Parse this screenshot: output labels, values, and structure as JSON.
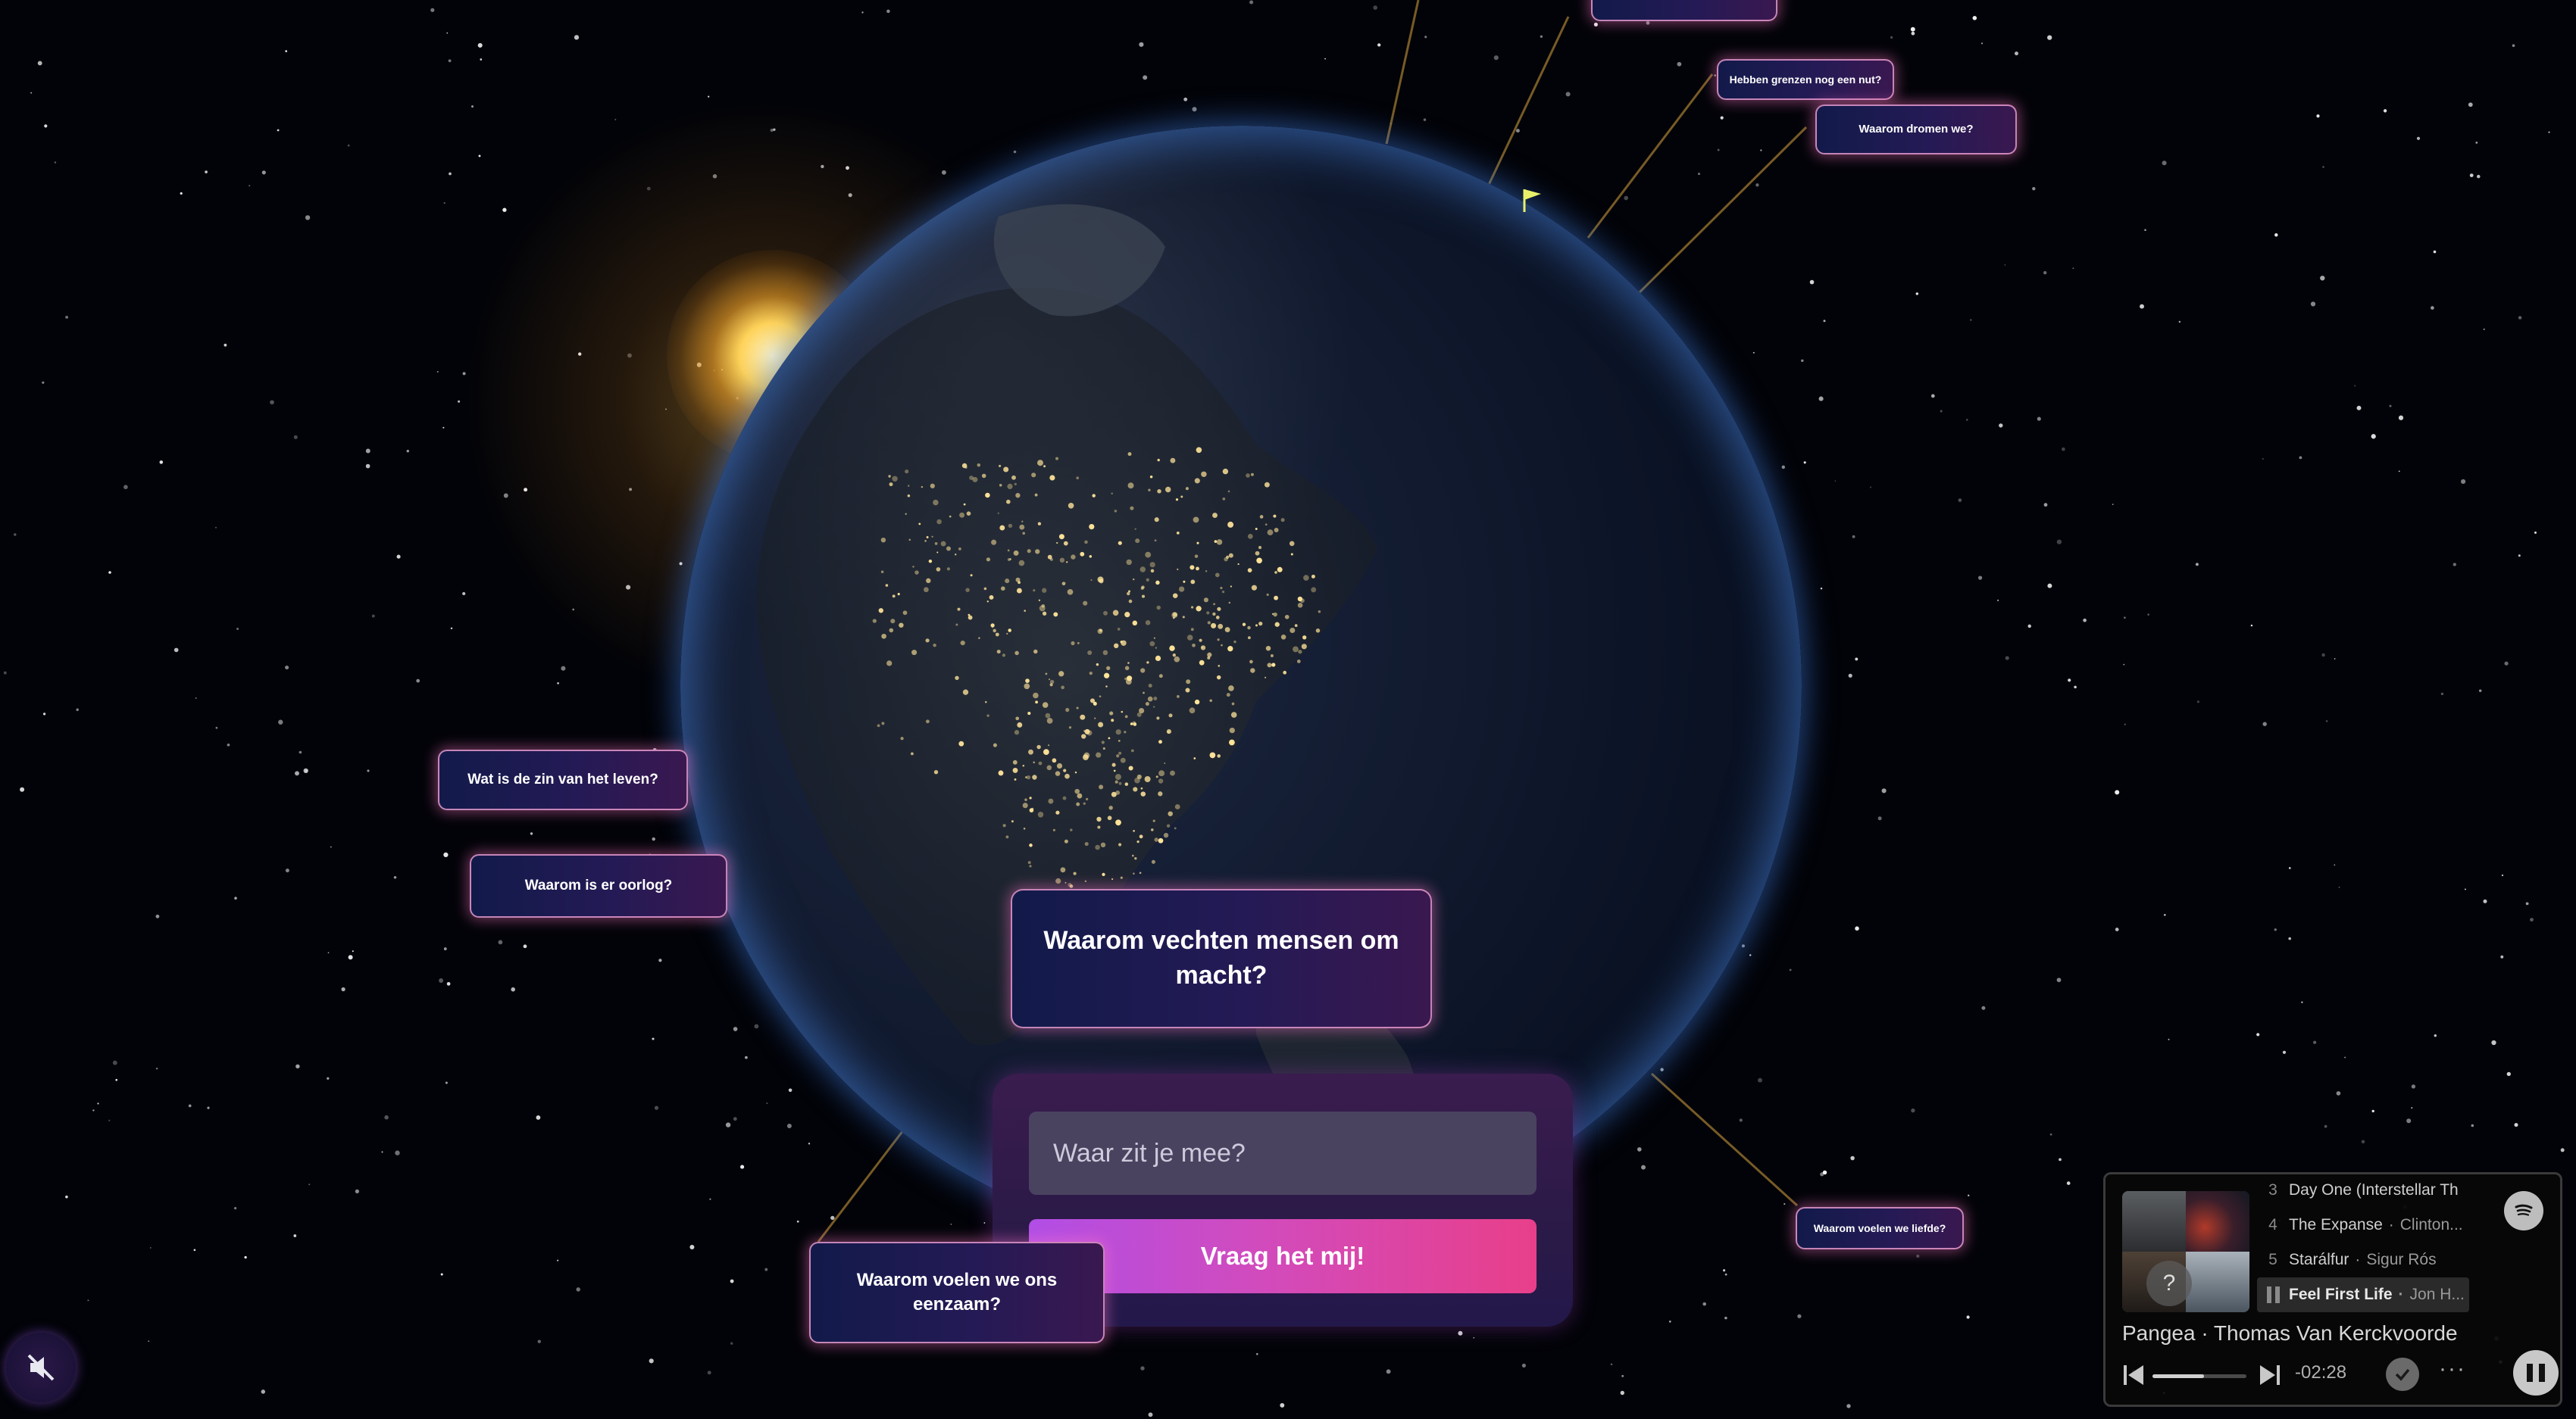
{
  "colors": {
    "background": "#020308",
    "bubble_start": "#121a4a",
    "bubble_end": "#3a1850",
    "bubble_border": "#ffaadc",
    "button_gradient_start": "#b14ee6",
    "button_gradient_end": "#e83f8a",
    "connector_line": "#d9a440",
    "city_lights": "#ffe49a"
  },
  "questions": [
    "Hebben grenzen nog een nut?",
    "Waarom dromen we?",
    "Wat is de zin van het leven?",
    "Waarom is er oorlog?",
    "Waarom voelen we liefde?",
    "Waarom voelen we ons eenzaam?"
  ],
  "featured_question": "Waarom vechten mensen om macht?",
  "ask": {
    "placeholder": "Waar zit je mee?",
    "button_label": "Vraag het mij!"
  },
  "mute_icon": "speaker-muted-icon",
  "player": {
    "service_icon": "spotify-icon",
    "queue": [
      {
        "num": "3",
        "title": "Day One (Interstellar Th",
        "artist": ""
      },
      {
        "num": "4",
        "title": "The Expanse",
        "artist": "Clinton..."
      },
      {
        "num": "5",
        "title": "Starálfur",
        "artist": "Sigur Rós"
      },
      {
        "num": "",
        "title": "Feel First Life",
        "artist": "Jon H...",
        "current": true
      }
    ],
    "now_playing": "Pangea · Thomas Van Kerckvoorde",
    "time_remaining": "-02:28",
    "progress": 0.55
  }
}
